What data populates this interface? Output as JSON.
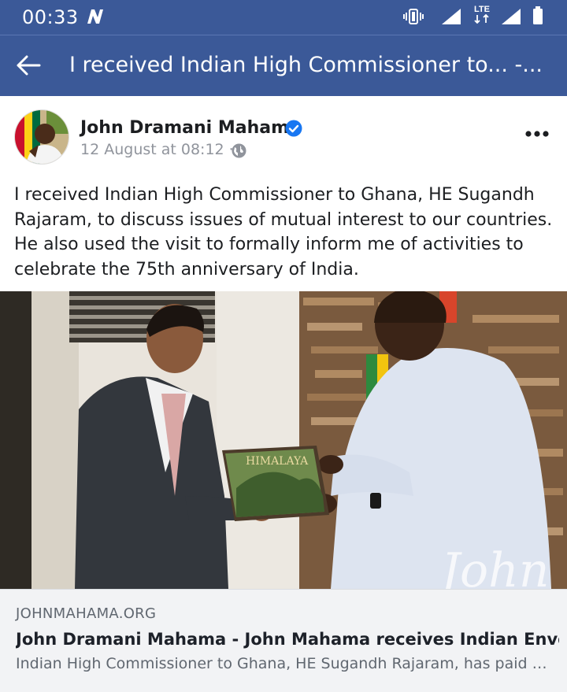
{
  "status_bar": {
    "time": "00:33",
    "network_label": "LTE",
    "icons": [
      "n-app-icon",
      "vibrate-icon",
      "signal-icon",
      "lte-icon",
      "signal-icon",
      "battery-icon"
    ]
  },
  "header": {
    "title": "I received Indian High Commissioner to... -..."
  },
  "post": {
    "author": "John Dramani Mahama",
    "meta": "12 August at 08:12 ·",
    "text": "I received Indian High Commissioner to Ghana, HE Sugandh Rajaram, to discuss issues of mutual interest to our countries. He also used the visit to formally inform me of activities to celebrate the 75th anniversary of India.",
    "photo": {
      "book_title": "HIMALAYA",
      "watermark": "John"
    },
    "link": {
      "domain": "JOHNMAHAMA.ORG",
      "title": "John Dramani Mahama - John Mahama receives Indian Envoy",
      "description": "Indian High Commissioner to Ghana, HE Sugandh Rajaram, has paid a c..."
    }
  },
  "colors": {
    "brand": "#3b5998",
    "verified": "#1877f2",
    "link_bg": "#f2f3f5"
  }
}
